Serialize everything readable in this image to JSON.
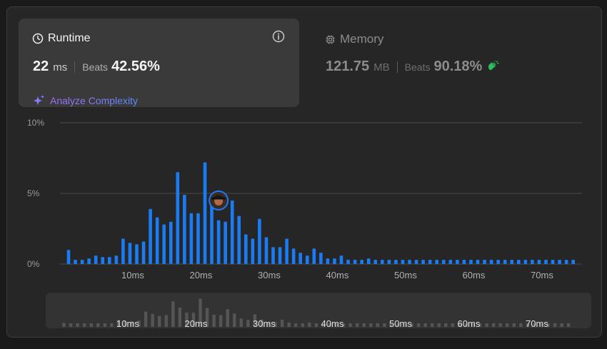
{
  "runtime": {
    "title": "Runtime",
    "value": "22",
    "unit": "ms",
    "beats_label": "Beats",
    "beats_value": "42.56%",
    "analyze_label": "Analyze Complexity"
  },
  "memory": {
    "title": "Memory",
    "value": "121.75",
    "unit": "MB",
    "beats_label": "Beats",
    "beats_value": "90.18%"
  },
  "colors": {
    "bar": "#1a7cf5",
    "mini_bar": "#555555",
    "grid": "#4a4a4a",
    "clap": "#2cbb5d"
  },
  "chart_data": {
    "type": "bar",
    "y_tick_labels": [
      "0%",
      "5%",
      "10%"
    ],
    "ylim": [
      0,
      10
    ],
    "x_tick_labels": [
      "10ms",
      "20ms",
      "30ms",
      "40ms",
      "50ms",
      "60ms",
      "70ms"
    ],
    "x_tick_values": [
      10,
      20,
      30,
      40,
      50,
      60,
      70
    ],
    "x_start": 1,
    "x_step": 1,
    "values": [
      1.0,
      0.3,
      0.3,
      0.4,
      0.6,
      0.5,
      0.5,
      0.6,
      1.8,
      1.5,
      1.4,
      1.6,
      3.9,
      3.3,
      2.8,
      3.0,
      6.5,
      4.9,
      3.6,
      3.6,
      7.2,
      4.8,
      3.1,
      3.0,
      4.5,
      3.4,
      2.1,
      1.8,
      3.2,
      1.9,
      1.2,
      1.2,
      1.8,
      1.1,
      0.8,
      0.6,
      1.1,
      0.8,
      0.4,
      0.4,
      0.6,
      0.3,
      0.3,
      0.3,
      0.4,
      0.3,
      0.3,
      0.3,
      0.3,
      0.3,
      0.3,
      0.3,
      0.3,
      0.3,
      0.3,
      0.3,
      0.3,
      0.3,
      0.3,
      0.3,
      0.3,
      0.3,
      0.3,
      0.3,
      0.3,
      0.3,
      0.3,
      0.3,
      0.3,
      0.3,
      0.3,
      0.3,
      0.3,
      0.3,
      0.3
    ],
    "marker_x": 23,
    "marker_y": 4.5,
    "grid": true
  }
}
